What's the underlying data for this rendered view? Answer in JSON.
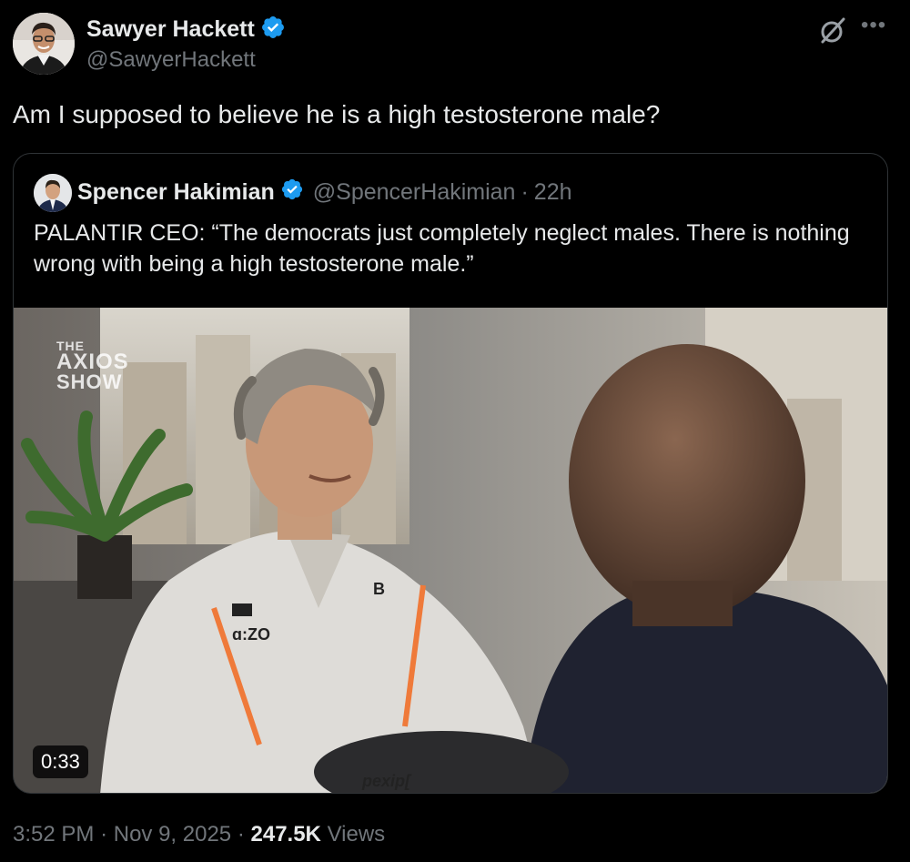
{
  "author": {
    "name": "Sawyer Hackett",
    "handle": "@SawyerHackett"
  },
  "tweet": {
    "text": "Am I supposed to believe he is a high testosterone male?"
  },
  "quoted": {
    "name": "Spencer Hakimian",
    "handle": "@SpencerHakimian",
    "separator": "·",
    "time": "22h",
    "text": "PALANTIR CEO: “The democrats just completely neglect males. There is nothing wrong with being a high testosterone male.”",
    "video": {
      "duration": "0:33",
      "overlay_logo": {
        "line1": "THE",
        "line2": "AXIOS",
        "line3": "SHOW"
      },
      "jacket_text": "pexip["
    }
  },
  "meta": {
    "time": "3:52 PM",
    "sep1": "·",
    "date": "Nov 9, 2025",
    "sep2": "·",
    "views_count": "247.5K",
    "views_label": "Views"
  },
  "icons": {
    "verified": "verified-badge-icon",
    "grok": "grok-icon",
    "more": "more-options-icon"
  },
  "colors": {
    "background": "#000000",
    "text": "#e7e9ea",
    "secondary": "#71767b",
    "verified_blue": "#1d9bf0",
    "border": "#2f3336"
  }
}
